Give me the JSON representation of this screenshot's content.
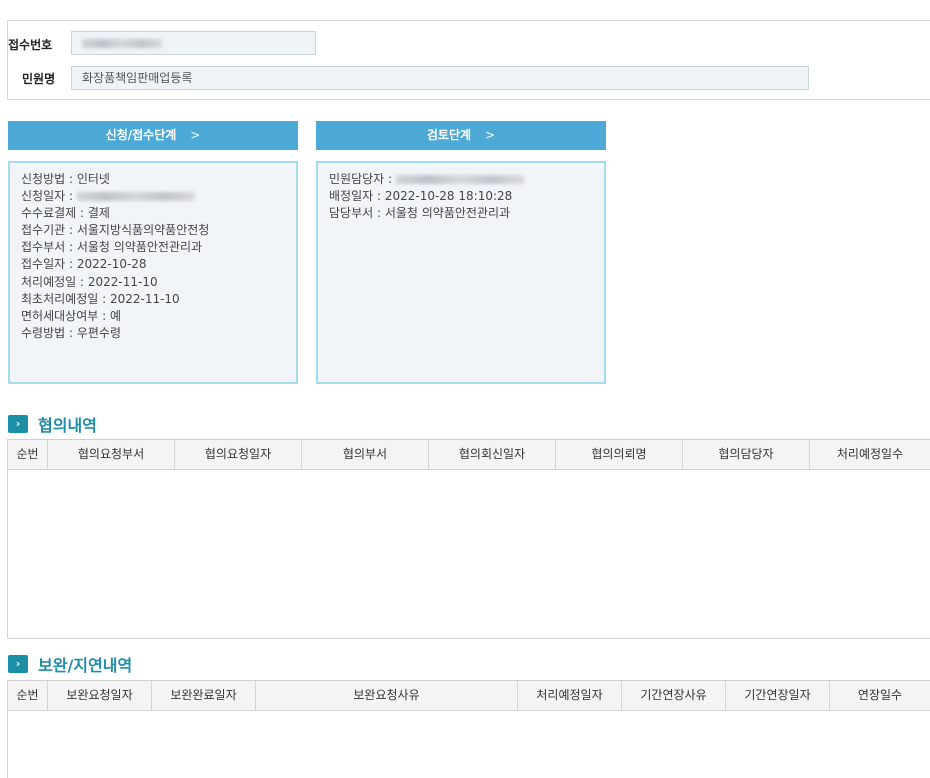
{
  "form": {
    "receipt_no_label": "접수번호",
    "civil_name_label": "민원명",
    "civil_name_value": "화장품책임판매업등록"
  },
  "steps": {
    "application": {
      "title": "신청/접수단계",
      "arrow": ">",
      "rows": [
        "신청방법 : 인터넷",
        "신청일자 :",
        "수수료결제 : 결제",
        "접수기관 : 서울지방식품의약품안전청",
        "접수부서 : 서울청 의약품안전관리과",
        "접수일자 : 2022-10-28",
        "처리예정일 : 2022-11-10",
        "최초처리예정일 : 2022-11-10",
        "면허세대상여부 : 예",
        "수령방법 : 우편수령"
      ]
    },
    "review": {
      "title": "검토단계",
      "arrow": ">",
      "rows": [
        "민원담당자 : ",
        "배정일자 : 2022-10-28 18:10:28",
        "담당부서 : 서울청 의약품안전관리과"
      ]
    }
  },
  "consultation": {
    "title": "협의내역",
    "columns": [
      "순번",
      "협의요청부서",
      "협의요청일자",
      "협의부서",
      "협의회신일자",
      "협의의뢰명",
      "협의담당자",
      "처리예정일수"
    ],
    "rows": []
  },
  "supplement": {
    "title": "보완/지연내역",
    "columns": [
      "순번",
      "보완요청일자",
      "보완완료일자",
      "보완요청사유",
      "처리예정일자",
      "기간연장사유",
      "기간연장일자",
      "연장일수"
    ],
    "rows": []
  },
  "icons": {
    "section_icon": "chevron-right-icon"
  },
  "colors": {
    "step_header": "#4da9d6",
    "panel_border": "#a4dcec",
    "panel_bg": "#f1f5f9",
    "section_title": "#1f8ea8",
    "section_icon_bg": "#1b8fa6"
  }
}
